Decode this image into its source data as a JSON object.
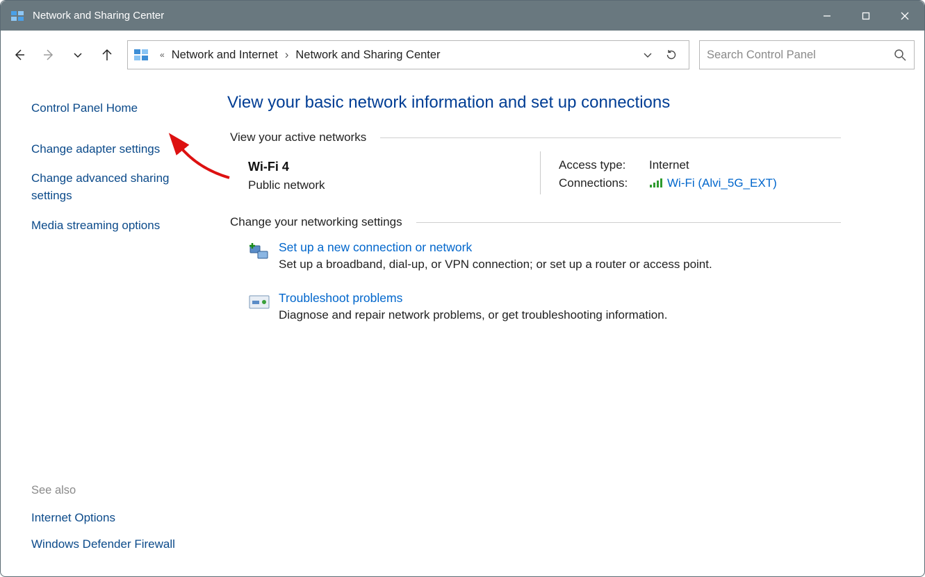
{
  "window": {
    "title": "Network and Sharing Center"
  },
  "breadcrumb": {
    "parent": "Network and Internet",
    "current": "Network and Sharing Center"
  },
  "search": {
    "placeholder": "Search Control Panel"
  },
  "sidebar": {
    "home": "Control Panel Home",
    "links": [
      "Change adapter settings",
      "Change advanced sharing settings",
      "Media streaming options"
    ],
    "see_also_label": "See also",
    "see_also": [
      "Internet Options",
      "Windows Defender Firewall"
    ]
  },
  "main": {
    "heading": "View your basic network information and set up connections",
    "section_active": "View your active networks",
    "network": {
      "name": "Wi-Fi 4",
      "scope": "Public network",
      "access_label": "Access type:",
      "access_value": "Internet",
      "conn_label": "Connections:",
      "conn_value": "Wi-Fi (Alvi_5G_EXT)"
    },
    "section_change": "Change your networking settings",
    "setup": {
      "title": "Set up a new connection or network",
      "desc": "Set up a broadband, dial-up, or VPN connection; or set up a router or access point."
    },
    "troubleshoot": {
      "title": "Troubleshoot problems",
      "desc": "Diagnose and repair network problems, or get troubleshooting information."
    }
  }
}
